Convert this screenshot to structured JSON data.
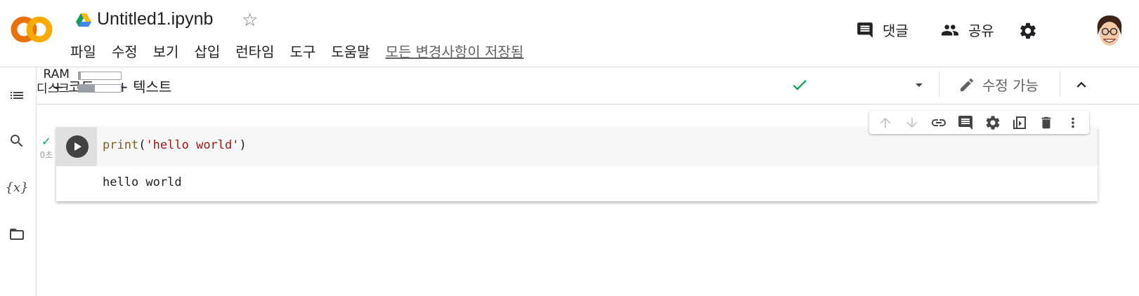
{
  "header": {
    "title": "Untitled1.ipynb",
    "menu": [
      "파일",
      "수정",
      "보기",
      "삽입",
      "런타임",
      "도구",
      "도움말"
    ],
    "save_status": "모든 변경사항이 저장됨",
    "comment_label": "댓글",
    "share_label": "공유"
  },
  "toolbar": {
    "add_code": "+ 코드",
    "add_text": "+ 텍스트",
    "ram_label": "RAM",
    "disk_label": "디스크",
    "ram_usage": 0.05,
    "disk_usage": 0.38,
    "edit_mode_label": "수정 가능"
  },
  "cell": {
    "code_kw": "print",
    "code_open": "(",
    "code_str": "'hello world'",
    "code_close": ")",
    "output": "hello world",
    "exec_time": "0초"
  },
  "colors": {
    "accent_orange": "#f9ab00",
    "logo_orange": "#e8710a",
    "check_green": "#00a651"
  },
  "icons": {
    "sidebar": [
      "toc-icon",
      "search-icon",
      "variables-icon",
      "folder-icon"
    ],
    "cell_toolbar": [
      "move-up-icon",
      "move-down-icon",
      "link-icon",
      "comment-icon",
      "settings-icon",
      "mirror-cell-icon",
      "delete-icon",
      "more-icon"
    ]
  }
}
